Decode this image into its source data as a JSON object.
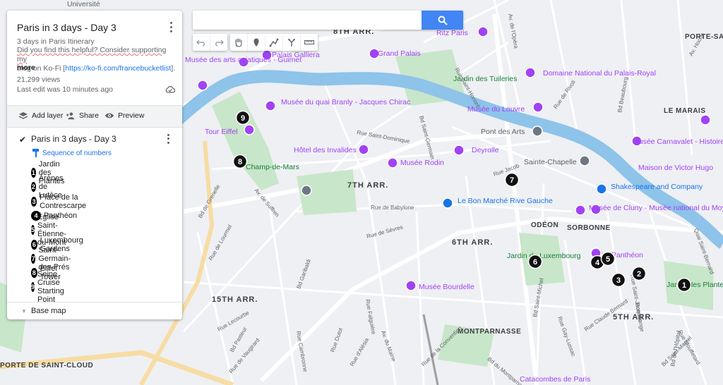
{
  "map": {
    "title": "Paris in 3 days - Day 3",
    "subtitle": "3 days in Paris Itinerary",
    "description_lines": [
      "Did you find this helpful? Consider supporting my",
      "blog on Ko-Fi ["
    ],
    "description_link": "https://ko-fi.com/francebucketlist",
    "description_end": "].",
    "more_label": "more",
    "views": "21,299 views",
    "last_edit": "Last edit was 10 minutes ago"
  },
  "actions": {
    "add_layer": "Add layer",
    "share": "Share",
    "preview": "Preview"
  },
  "layer": {
    "name": "Paris in 3 days - Day 3",
    "style_label": "Sequence of numbers",
    "items": [
      {
        "num": "1",
        "label": "Jardin des Plantes"
      },
      {
        "num": "2",
        "label": "Arènes de Lutèce"
      },
      {
        "num": "3",
        "label": "Place de la Contrescarpe"
      },
      {
        "num": "4",
        "label": "Panthéon"
      },
      {
        "num": "5",
        "label": "Église Saint-Étienne-du-Mont"
      },
      {
        "num": "6",
        "label": "Luxembourg Gardens"
      },
      {
        "num": "7",
        "label": "Saint-Germain-des-Prés"
      },
      {
        "num": "8",
        "label": "Eiffel Tower"
      },
      {
        "num": "9",
        "label": "Seine Cruise Starting Point"
      }
    ]
  },
  "base_map_label": "Base map",
  "search": {
    "placeholder": ""
  },
  "toolbar_icons": [
    "undo-icon",
    "redo-icon",
    "hand-icon",
    "marker-icon",
    "draw-line-icon",
    "directions-icon",
    "ruler-icon"
  ],
  "markers": [
    "1",
    "2",
    "3",
    "4",
    "5",
    "6",
    "7",
    "8",
    "9"
  ],
  "map_labels": {
    "arrondissements": [
      "8TH ARR.",
      "7TH ARR.",
      "6TH ARR.",
      "15TH ARR.",
      "5TH ARR."
    ],
    "districts": [
      "ODÉON",
      "SORBONNE",
      "MONTPARNASSE",
      "LE MARAIS",
      "PORTE-SAINT-M",
      "PORTE DE SAINT-CLOUD"
    ],
    "places": [
      "Université",
      "Ritz Paris",
      "Palais Galliera",
      "Grand Palais",
      "Musée des arts asiatiques - Guimet",
      "Domaine National du Palais-Royal",
      "Musée du quai Branly - Jacques Chirac",
      "Jardin des Tuileries",
      "Musée du Louvre",
      "Tour Eiffel",
      "Pont des Arts",
      "Musée Carnavalet - Histoire de Paris",
      "Hôtel des Invalides",
      "Musée Rodin",
      "Deyrolle",
      "Sainte-Chapelle",
      "Maison de Victor Hugo",
      "Champ-de-Mars",
      "Shakespeare and Company",
      "Le Bon Marché Rive Gauche",
      "Musée de Cluny - Musée national du Moyen Âge",
      "Jardin du Luxembourg",
      "Panthéon",
      "Musée Bourdelle",
      "Jardin des Plantes",
      "Catacombes de Paris"
    ],
    "streets": [
      "Rue Saint-Honoré",
      "Rue Saint-Dominique",
      "Bd Saint-Germain",
      "Rue de Rivoli",
      "Bd Beaubourg",
      "Rue Jacob",
      "Rue de Babylone",
      "Rue de Sèvres",
      "Rue Lecourbe",
      "Bd Pasteur",
      "Rue de Vaugirard",
      "Rue Cambronne",
      "Rue Saint-Jacques",
      "Bd Saint-Michel",
      "Rue Gay-Lussac",
      "Rue Claude Bernard",
      "Rue Monge",
      "Rue Mouffetard",
      "Bd Saint-Marcel",
      "Bd de l'Hôpital",
      "Av. de Suffren",
      "Bd de Grenelle",
      "Rue de Lourmel",
      "Bd Garibaldi",
      "Rue Dutot",
      "Rue d'Alésia",
      "Av. du Maine",
      "Rue de la Convention",
      "Av. Victor Hugo",
      "Av. de l'Opéra",
      "Av. Hoche",
      "Rue Falguière",
      "Bd du Montparnasse",
      "Quai Saint-Bernard"
    ]
  },
  "colors": {
    "accent": "#4285f4",
    "seine": "#8ec3ea",
    "park": "#c8e6c9",
    "poi": "#a142f4",
    "marker": "#000000"
  }
}
